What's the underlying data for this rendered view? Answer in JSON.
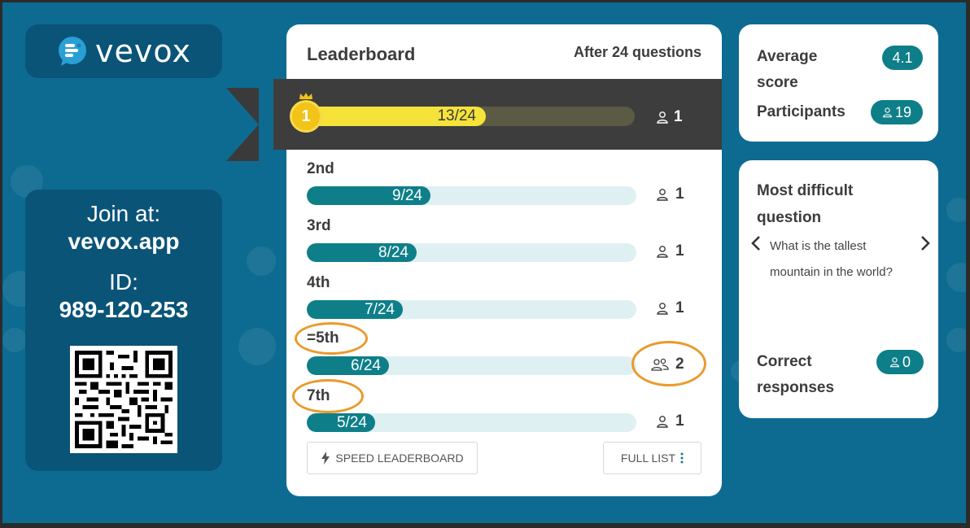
{
  "brand": {
    "name": "vevox"
  },
  "join": {
    "label": "Join at:",
    "url": "vevox.app",
    "id_label": "ID:",
    "id_value": "989-120-253"
  },
  "leaderboard": {
    "title": "Leaderboard",
    "subtitle": "After 24 questions",
    "first": {
      "medal": "1",
      "score": "13/24",
      "fraction": 0.542,
      "count": "1"
    },
    "rows": [
      {
        "label": "2nd",
        "score": "9/24",
        "fraction": 0.375,
        "count": "1",
        "icon": "person-icon"
      },
      {
        "label": "3rd",
        "score": "8/24",
        "fraction": 0.333,
        "count": "1",
        "icon": "person-icon"
      },
      {
        "label": "4th",
        "score": "7/24",
        "fraction": 0.292,
        "count": "1",
        "icon": "person-icon"
      },
      {
        "label": "=5th",
        "score": "6/24",
        "fraction": 0.25,
        "count": "2",
        "icon": "group-icon"
      },
      {
        "label": "7th",
        "score": "5/24",
        "fraction": 0.208,
        "count": "1",
        "icon": "person-icon"
      }
    ],
    "speed_button": "SPEED LEADERBOARD",
    "full_list_button": "FULL LIST"
  },
  "stats": {
    "average_label_1": "Average",
    "average_label_2": "score",
    "average_value": "4.1",
    "participants_label": "Participants",
    "participants_value": "19"
  },
  "difficult": {
    "title_1": "Most difficult",
    "title_2": "question",
    "question_1": "What is the tallest",
    "question_2": "mountain in the world?",
    "correct_label_1": "Correct",
    "correct_label_2": "responses",
    "correct_value": "0"
  },
  "colors": {
    "background": "#0d6b91",
    "panel": "#0a5478",
    "teal": "#0e7f89",
    "gold": "#f5e33a",
    "highlight": "#eb9a2b"
  }
}
